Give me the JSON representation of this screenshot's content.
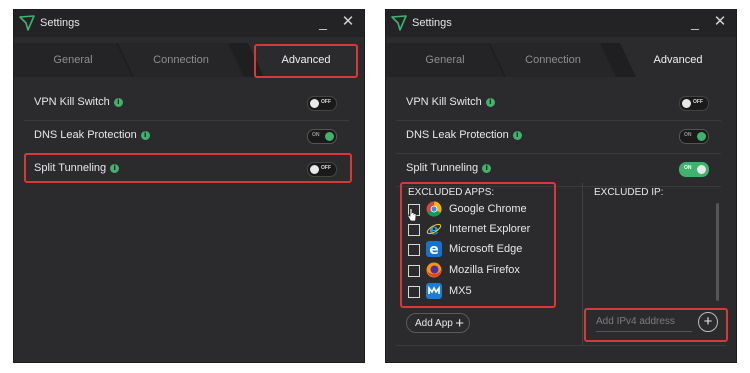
{
  "left_window": {
    "title": "Settings",
    "minimize_glyph": "_",
    "close_glyph": "✕",
    "tabs": [
      {
        "label": "General",
        "active": false
      },
      {
        "label": "Connection",
        "active": false
      },
      {
        "label": "Advanced",
        "active": true
      }
    ],
    "settings": [
      {
        "label": "VPN Kill Switch",
        "state": "OFF"
      },
      {
        "label": "DNS Leak Protection",
        "state": "ON"
      },
      {
        "label": "Split Tunneling",
        "state": "OFF"
      }
    ]
  },
  "right_window": {
    "title": "Settings",
    "minimize_glyph": "_",
    "close_glyph": "✕",
    "tabs": [
      {
        "label": "General",
        "active": false
      },
      {
        "label": "Connection",
        "active": false
      },
      {
        "label": "Advanced",
        "active": true
      }
    ],
    "settings": [
      {
        "label": "VPN Kill Switch",
        "state": "OFF"
      },
      {
        "label": "DNS Leak Protection",
        "state": "ON"
      },
      {
        "label": "Split Tunneling",
        "state": "ON"
      }
    ],
    "excluded_apps_header": "EXCLUDED APPS:",
    "excluded_ip_header": "EXCLUDED IP:",
    "apps": [
      {
        "name": "Google Chrome",
        "icon": "chrome-icon"
      },
      {
        "name": "Internet Explorer",
        "icon": "internet-explorer-icon"
      },
      {
        "name": "Microsoft Edge",
        "icon": "edge-icon"
      },
      {
        "name": "Mozilla Firefox",
        "icon": "firefox-icon"
      },
      {
        "name": "MX5",
        "icon": "mx5-icon"
      }
    ],
    "add_app_label": "Add App",
    "ip_placeholder": "Add IPv4 address"
  },
  "colors": {
    "window_bg": "#2b2b2d",
    "accent_green": "#3fb26d",
    "highlight_red": "#d9383a"
  }
}
